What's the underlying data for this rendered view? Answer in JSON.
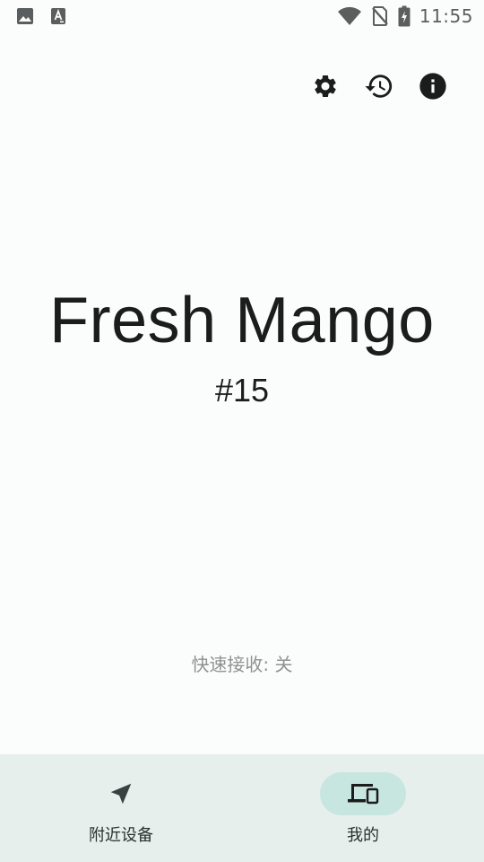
{
  "status_bar": {
    "time": "11:55",
    "left_icons": [
      "image-icon",
      "text-notification-icon"
    ],
    "right_icons": [
      "wifi-icon",
      "no-sim-icon",
      "battery-charging-icon"
    ]
  },
  "toolbar": {
    "icons": [
      "settings-icon",
      "history-icon",
      "info-icon"
    ]
  },
  "device": {
    "name": "Fresh Mango",
    "id": "#15"
  },
  "quick_receive": {
    "text": "快速接收: 关"
  },
  "bottom_nav": {
    "items": [
      {
        "label": "附近设备",
        "icon": "navigation-arrow-icon",
        "active": false
      },
      {
        "label": "我的",
        "icon": "devices-icon",
        "active": true
      }
    ]
  },
  "colors": {
    "background": "#fbfdfc",
    "nav_background": "#e6efec",
    "active_pill": "#c7e6df",
    "text_primary": "#1b1c1c",
    "text_muted": "#8e9292"
  }
}
